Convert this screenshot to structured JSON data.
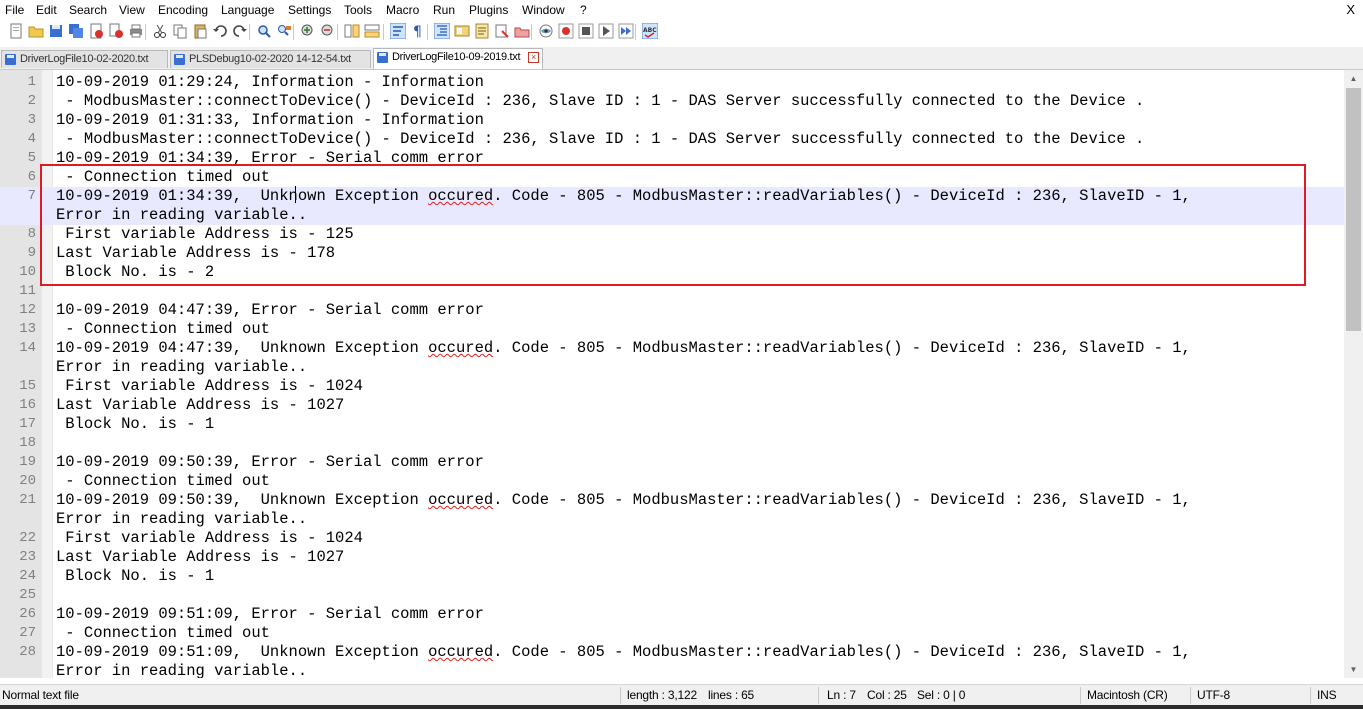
{
  "menu": [
    "File",
    "Edit",
    "Search",
    "View",
    "Encoding",
    "Language",
    "Settings",
    "Tools",
    "Macro",
    "Run",
    "Plugins",
    "Window",
    "?"
  ],
  "window_close": "X",
  "toolbar_icons": [
    "new-file-icon",
    "open-file-icon",
    "save-icon",
    "save-all-icon",
    "close-icon",
    "close-all-icon",
    "print-icon",
    "cut-icon",
    "copy-icon",
    "paste-icon",
    "undo-icon",
    "redo-icon",
    "find-icon",
    "replace-icon",
    "zoom-in-icon",
    "zoom-out-icon",
    "sync-vertical-icon",
    "sync-horizontal-icon",
    "word-wrap-icon",
    "show-all-characters-icon",
    "indent-guide-icon",
    "document-map-icon",
    "function-list-icon",
    "folder-workspace-icon",
    "monitoring-icon",
    "record-macro-icon",
    "stop-recording-icon",
    "play-macro-icon",
    "run-macro-multiple-icon",
    "save-macro-icon",
    "spell-check-icon"
  ],
  "tabs": [
    {
      "label": "DriverLogFile10-02-2020.txt",
      "active": false
    },
    {
      "label": "PLSDebug10-02-2020 14-12-54.txt",
      "active": false
    },
    {
      "label": "DriverLogFile10-09-2019.txt",
      "active": true
    }
  ],
  "lines": [
    {
      "n": "1",
      "text": "10-09-2019 01:29:24, Information - Information"
    },
    {
      "n": "2",
      "text": " - ModbusMaster::connectToDevice() - DeviceId : 236, Slave ID : 1 - DAS Server successfully connected to the Device ."
    },
    {
      "n": "3",
      "text": "10-09-2019 01:31:33, Information - Information"
    },
    {
      "n": "4",
      "text": " - ModbusMaster::connectToDevice() - DeviceId : 236, Slave ID : 1 - DAS Server successfully connected to the Device ."
    },
    {
      "n": "5",
      "text": "10-09-2019 01:34:39, Error - Serial comm error"
    },
    {
      "n": "6",
      "text": " - Connection timed out"
    },
    {
      "n": "7",
      "a": "10-09-2019 01:34:39,  Unknown Exception ",
      "sq": "occured",
      "b": ". Code - 805 - ModbusMaster::readVariables() - DeviceId : 236, SlaveID - 1,",
      "cont": "Error in reading variable..",
      "current": true
    },
    {
      "n": "8",
      "text": " First variable Address is - 125"
    },
    {
      "n": "9",
      "text": "Last Variable Address is - 178"
    },
    {
      "n": "10",
      "text": " Block No. is - 2"
    },
    {
      "n": "11",
      "text": ""
    },
    {
      "n": "12",
      "text": "10-09-2019 04:47:39, Error - Serial comm error"
    },
    {
      "n": "13",
      "text": " - Connection timed out"
    },
    {
      "n": "14",
      "a": "10-09-2019 04:47:39,  Unknown Exception ",
      "sq": "occured",
      "b": ". Code - 805 - ModbusMaster::readVariables() - DeviceId : 236, SlaveID - 1,",
      "cont": "Error in reading variable.."
    },
    {
      "n": "15",
      "text": " First variable Address is - 1024"
    },
    {
      "n": "16",
      "text": "Last Variable Address is - 1027"
    },
    {
      "n": "17",
      "text": " Block No. is - 1"
    },
    {
      "n": "18",
      "text": ""
    },
    {
      "n": "19",
      "text": "10-09-2019 09:50:39, Error - Serial comm error"
    },
    {
      "n": "20",
      "text": " - Connection timed out"
    },
    {
      "n": "21",
      "a": "10-09-2019 09:50:39,  Unknown Exception ",
      "sq": "occured",
      "b": ". Code - 805 - ModbusMaster::readVariables() - DeviceId : 236, SlaveID - 1,",
      "cont": "Error in reading variable.."
    },
    {
      "n": "22",
      "text": " First variable Address is - 1024"
    },
    {
      "n": "23",
      "text": "Last Variable Address is - 1027"
    },
    {
      "n": "24",
      "text": " Block No. is - 1"
    },
    {
      "n": "25",
      "text": ""
    },
    {
      "n": "26",
      "text": "10-09-2019 09:51:09, Error - Serial comm error"
    },
    {
      "n": "27",
      "text": " - Connection timed out"
    },
    {
      "n": "28",
      "a": "10-09-2019 09:51:09,  Unknown Exception ",
      "sq": "occured",
      "b": ". Code - 805 - ModbusMaster::readVariables() - DeviceId : 236, SlaveID - 1,",
      "cont": "Error in reading variable.."
    }
  ],
  "status": {
    "file_type": "Normal text file",
    "length": "length : 3,122",
    "lines": "lines : 65",
    "ln": "Ln : 7",
    "col": "Col : 25",
    "sel": "Sel : 0 | 0",
    "eol": "Macintosh (CR)",
    "encoding": "UTF-8",
    "mode": "INS"
  },
  "colors": {
    "highlight_box": "#e01a22",
    "current_line": "#e8e8ff",
    "gutter": "#e4e4e4",
    "line_number": "#808080"
  }
}
